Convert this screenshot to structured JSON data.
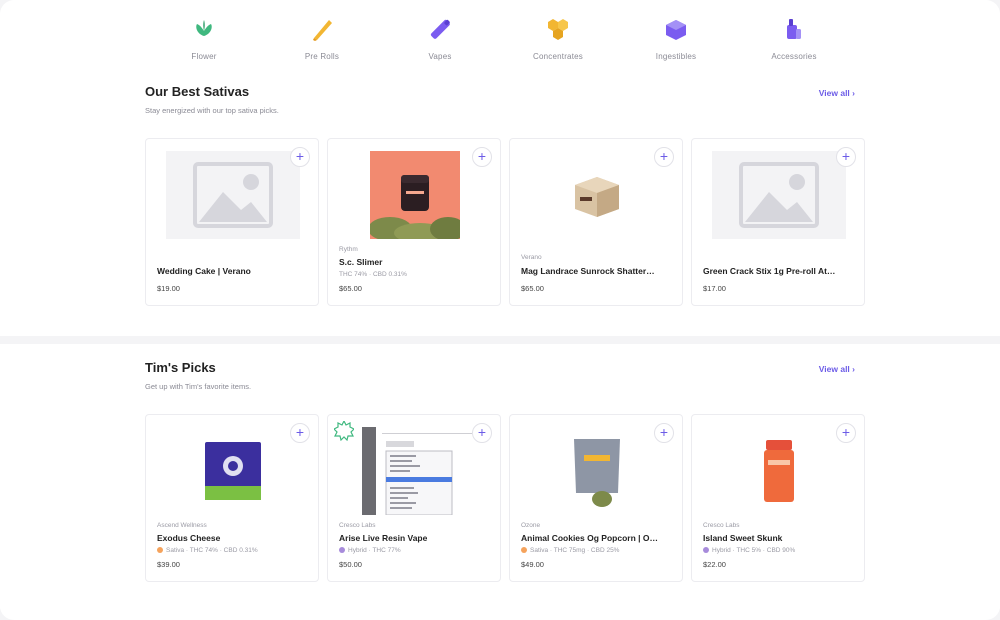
{
  "categories": [
    {
      "label": "Flower",
      "icon": "flower-icon"
    },
    {
      "label": "Pre Rolls",
      "icon": "pre-roll-icon"
    },
    {
      "label": "Vapes",
      "icon": "vape-icon"
    },
    {
      "label": "Concentrates",
      "icon": "concentrates-icon"
    },
    {
      "label": "Ingestibles",
      "icon": "ingestibles-icon"
    },
    {
      "label": "Accessories",
      "icon": "accessories-icon"
    }
  ],
  "sections": [
    {
      "title": "Our Best Sativas",
      "subtitle": "Stay energized with our top sativa picks.",
      "view_all": "View all ›",
      "products": [
        {
          "brand": "",
          "name": "Wedding Cake | Verano",
          "meta": "",
          "price": "$19.00",
          "image": "placeholder"
        },
        {
          "brand": "Rythm",
          "name": "S.c. Slimer",
          "meta": "THC 74% · CBD 0.31%",
          "price": "$65.00",
          "image": "jar-photo"
        },
        {
          "brand": "Verano",
          "name": "Mag Landrace Sunrock Shatter…",
          "meta": "",
          "price": "$65.00",
          "image": "box-photo"
        },
        {
          "brand": "",
          "name": "Green Crack Stix 1g Pre-roll At…",
          "meta": "",
          "price": "$17.00",
          "image": "placeholder"
        }
      ]
    },
    {
      "title": "Tim's Picks",
      "subtitle": "Get up with Tim's favorite items.",
      "view_all": "View all ›",
      "products": [
        {
          "brand": "Ascend Wellness",
          "name": "Exodus Cheese",
          "meta": "Sativa · THC 74% · CBD 0.31%",
          "strain": "sativa",
          "price": "$39.00",
          "image": "bag-photo"
        },
        {
          "brand": "Cresco Labs",
          "name": "Arise Live Resin Vape",
          "meta": "Hybrid · THC 77%",
          "strain": "hybrid",
          "price": "$50.00",
          "image": "vape-screenshot"
        },
        {
          "brand": "Ozone",
          "name": "Animal Cookies Og Popcorn | O…",
          "meta": "Sativa · THC 75mg · CBD 25%",
          "strain": "sativa",
          "price": "$49.00",
          "image": "pouch-photo"
        },
        {
          "brand": "Cresco Labs",
          "name": "Island Sweet Skunk",
          "meta": "Hybrid · THC 5% · CBD 90%",
          "strain": "hybrid",
          "price": "$22.00",
          "image": "bottle-photo"
        }
      ]
    }
  ],
  "colors": {
    "accent": "#6c5ce7",
    "flower": "#3fb87f",
    "preroll": "#f2b632",
    "sativa": "#f5a35c",
    "hybrid": "#a78bdb"
  }
}
